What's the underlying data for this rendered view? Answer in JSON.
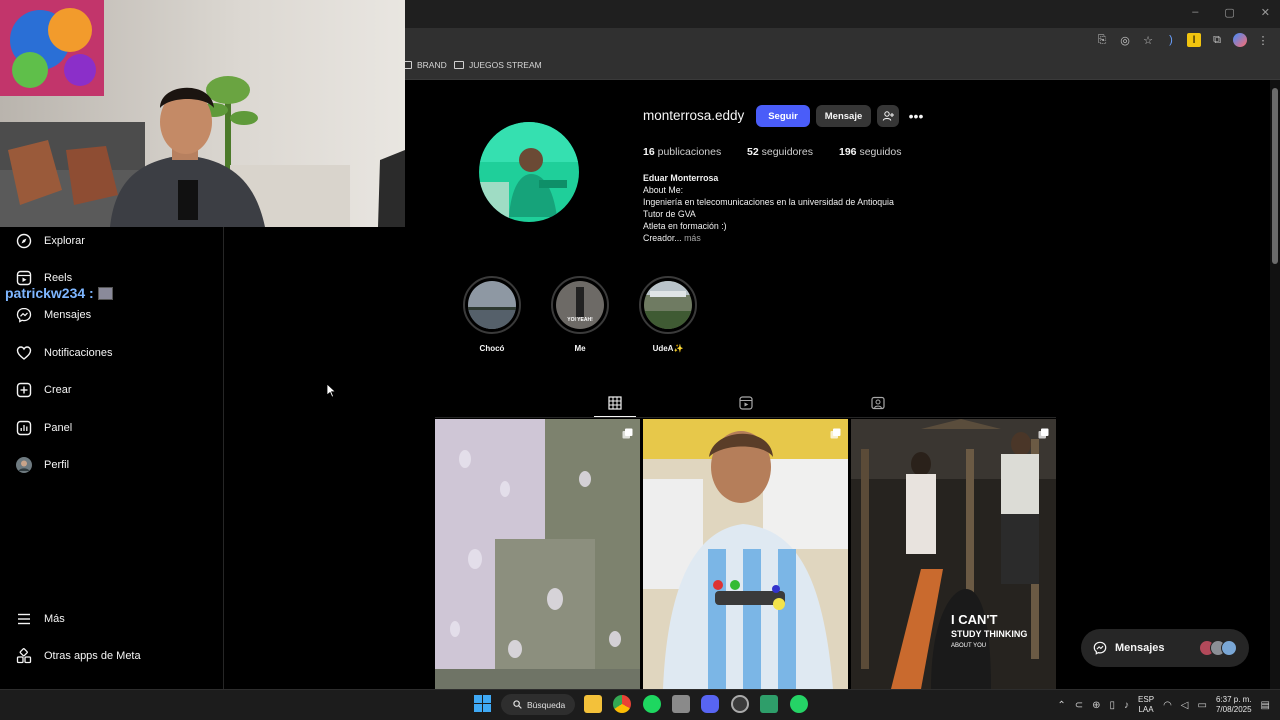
{
  "browser": {
    "bookmarks": [
      "BRAND",
      "JUEGOS STREAM"
    ],
    "window_controls": [
      "–",
      "▢",
      "✕"
    ]
  },
  "overlay": {
    "chat_username": "patrickw234 :"
  },
  "sidebar": {
    "items": [
      {
        "label": "Explorar",
        "icon": "compass-icon"
      },
      {
        "label": "Reels",
        "icon": "reels-icon"
      },
      {
        "label": "Mensajes",
        "icon": "messenger-icon"
      },
      {
        "label": "Notificaciones",
        "icon": "heart-icon"
      },
      {
        "label": "Crear",
        "icon": "plus-square-icon"
      },
      {
        "label": "Panel",
        "icon": "bar-chart-icon"
      },
      {
        "label": "Perfil",
        "icon": "avatar"
      }
    ],
    "bottom": [
      {
        "label": "Más",
        "icon": "menu-icon"
      },
      {
        "label": "Otras apps de Meta",
        "icon": "meta-apps-icon"
      }
    ]
  },
  "profile": {
    "username": "monterrosa.eddy",
    "follow_label": "Seguir",
    "message_label": "Mensaje",
    "stats": {
      "posts_count": "16",
      "posts_label": "publicaciones",
      "followers_count": "52",
      "followers_label": "seguidores",
      "following_count": "196",
      "following_label": "seguidos"
    },
    "bio": {
      "name": "Eduar Monterrosa",
      "lines": [
        "About Me:",
        "Ingeniería en telecomunicaciones en la universidad de Antioquia",
        "Tutor de GVA",
        "Atleta en formación :)"
      ],
      "truncated_line": "Creador...",
      "more_label": "más"
    },
    "highlights": [
      {
        "label": "Chocó"
      },
      {
        "label": "Me",
        "thumb_text": "YOI YEAH!"
      },
      {
        "label": "UdeA✨"
      }
    ],
    "tabs": [
      "grid-icon",
      "reels-icon",
      "tagged-icon"
    ],
    "posts": [
      {
        "kind": "carousel",
        "caption": ""
      },
      {
        "kind": "carousel",
        "caption": ""
      },
      {
        "kind": "carousel",
        "caption": "I CAN'T STUDY THINKING ABOUT YOU"
      }
    ]
  },
  "floating_messages": {
    "label": "Mensajes"
  },
  "taskbar": {
    "search_label": "Búsqueda",
    "language_top": "ESP",
    "language_bottom": "LAA",
    "time": "6:37 p. m.",
    "date": "7/08/2025"
  },
  "colors": {
    "follow_button": "#4a5df9",
    "background": "#000000",
    "secondary_button": "#363636"
  }
}
